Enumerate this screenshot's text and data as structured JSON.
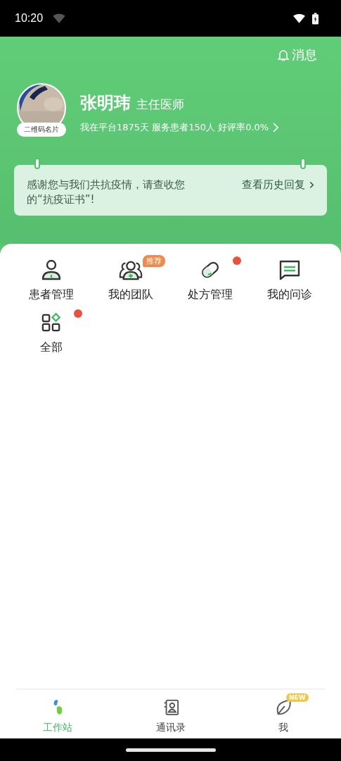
{
  "status_bar": {
    "time": "10:20"
  },
  "header": {
    "messages_label": "消息"
  },
  "profile": {
    "name": "张明玮",
    "title": "主任医师",
    "qr_label": "二维码名片",
    "stats": "我在平台1875天 服务患者150人 好评率0.0%"
  },
  "notice": {
    "text": "感谢您与我们共抗疫情，请查收您的“抗疫证书”!",
    "link": "查看历史回复"
  },
  "shortcuts": [
    {
      "label": "患者管理",
      "kind": "person",
      "dot": false
    },
    {
      "label": "我的团队",
      "kind": "team",
      "badge": "推荐",
      "dot": false
    },
    {
      "label": "处方管理",
      "kind": "pill",
      "dot": true
    },
    {
      "label": "我的问诊",
      "kind": "chat",
      "dot": false
    },
    {
      "label": "全部",
      "kind": "grid",
      "dot": true
    }
  ],
  "tabs": [
    {
      "label": "工作站",
      "kind": "station",
      "selected": true
    },
    {
      "label": "通讯录",
      "kind": "contacts",
      "selected": false
    },
    {
      "label": "我",
      "kind": "leaf",
      "badge": "NEW",
      "selected": false
    }
  ]
}
